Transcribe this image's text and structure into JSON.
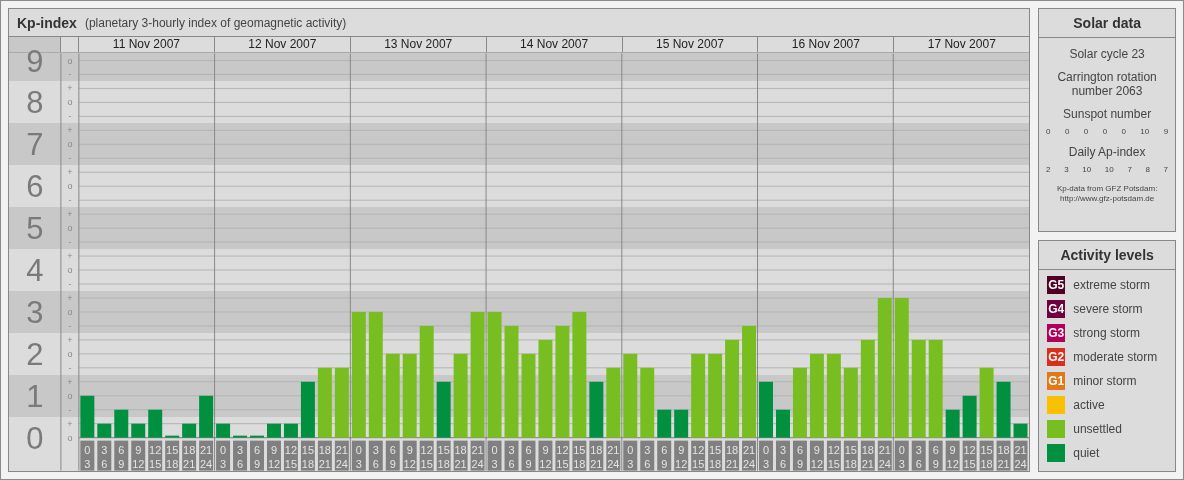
{
  "header": {
    "title": "Kp-index",
    "subtitle": "(planetary 3-hourly index of geomagnetic activity)"
  },
  "chart": {
    "day_labels": [
      "11 Nov 2007",
      "12 Nov 2007",
      "13 Nov 2007",
      "14 Nov 2007",
      "15 Nov 2007",
      "16 Nov 2007",
      "17 Nov 2007"
    ],
    "kp_marks": [
      "o",
      "-",
      "+",
      "o",
      "-",
      "+",
      "o",
      "-",
      "+",
      "o",
      "-",
      "+",
      "o",
      "-",
      "+",
      "o",
      "-",
      "+",
      "o",
      "-",
      "+",
      "o",
      "-",
      "+",
      "o",
      "-",
      "+",
      "o"
    ],
    "chart_data": {
      "type": "bar",
      "grid": true,
      "ylim": [
        0,
        9.17
      ],
      "yticks": [
        0,
        1,
        2,
        3,
        4,
        5,
        6,
        7,
        8,
        9
      ],
      "categories": [
        "0\n3",
        "3\n6",
        "6\n9",
        "9\n12",
        "12\n15",
        "15\n18",
        "18\n21",
        "21\n24",
        "0\n3",
        "3\n6",
        "6\n9",
        "9\n12",
        "12\n15",
        "15\n18",
        "18\n21",
        "21\n24",
        "0\n3",
        "3\n6",
        "6\n9",
        "9\n12",
        "12\n15",
        "15\n18",
        "18\n21",
        "21\n24",
        "0\n3",
        "3\n6",
        "6\n9",
        "9\n12",
        "12\n15",
        "15\n18",
        "18\n21",
        "21\n24",
        "0\n3",
        "3\n6",
        "6\n9",
        "9\n12",
        "12\n15",
        "15\n18",
        "18\n21",
        "21\n24",
        "0\n3",
        "3\n6",
        "6\n9",
        "9\n12",
        "12\n15",
        "15\n18",
        "18\n21",
        "21\n24",
        "0\n3",
        "3\n6",
        "6\n9",
        "9\n12",
        "12\n15",
        "15\n18",
        "18\n21",
        "21\n24"
      ],
      "series": [
        {
          "color": "#009040",
          "values": [
            1,
            0.33,
            0.67,
            0.33,
            0.67,
            0,
            0.33,
            1,
            0.33,
            0,
            0,
            0.33,
            0.33,
            1.33,
            null,
            null,
            null,
            null,
            null,
            null,
            null,
            1.33,
            null,
            null,
            null,
            null,
            null,
            null,
            null,
            null,
            1.33,
            null,
            null,
            null,
            0.67,
            0.67,
            null,
            null,
            null,
            null,
            1.33,
            0.67,
            null,
            null,
            null,
            null,
            null,
            null,
            null,
            null,
            null,
            0.67,
            1,
            null,
            1.33,
            0.33
          ]
        },
        {
          "color": "#78be20",
          "values": [
            null,
            null,
            null,
            null,
            null,
            null,
            null,
            null,
            null,
            null,
            null,
            null,
            null,
            null,
            1.67,
            1.67,
            3,
            3,
            2,
            2,
            2.67,
            null,
            2,
            3,
            3,
            2.67,
            2,
            2.33,
            2.67,
            3,
            null,
            1.67,
            2,
            1.67,
            null,
            null,
            2,
            2,
            2.33,
            2.67,
            null,
            null,
            1.67,
            2,
            2,
            1.67,
            2.33,
            3.33,
            3.33,
            2.33,
            2.33,
            null,
            null,
            1.67,
            null,
            null
          ]
        }
      ]
    }
  },
  "solar": {
    "title": "Solar data",
    "cycle": "Solar cycle 23",
    "rotation": "Carrington rotation number 2063",
    "sunspot_title": "Sunspot number",
    "sunspots": [
      "0",
      "0",
      "0",
      "0",
      "0",
      "10",
      "9"
    ],
    "ap_title": "Daily Ap-index",
    "ap": [
      "2",
      "3",
      "10",
      "10",
      "7",
      "8",
      "7"
    ],
    "source": [
      "Kp-data from GFZ Potsdam:",
      "http://www.gfz-potsdam.de"
    ]
  },
  "legend": {
    "title": "Activity levels",
    "items": [
      {
        "badge": "G5",
        "label": "extreme storm",
        "color": "#500024"
      },
      {
        "badge": "G4",
        "label": "severe storm",
        "color": "#700040"
      },
      {
        "badge": "G3",
        "label": "strong storm",
        "color": "#b0005a"
      },
      {
        "badge": "G2",
        "label": "moderate storm",
        "color": "#d8301c"
      },
      {
        "badge": "G1",
        "label": "minor storm",
        "color": "#e27818"
      },
      {
        "label": "active",
        "color": "#f8c000"
      },
      {
        "label": "unsettled",
        "color": "#78be20"
      },
      {
        "label": "quiet",
        "color": "#009040"
      }
    ]
  }
}
